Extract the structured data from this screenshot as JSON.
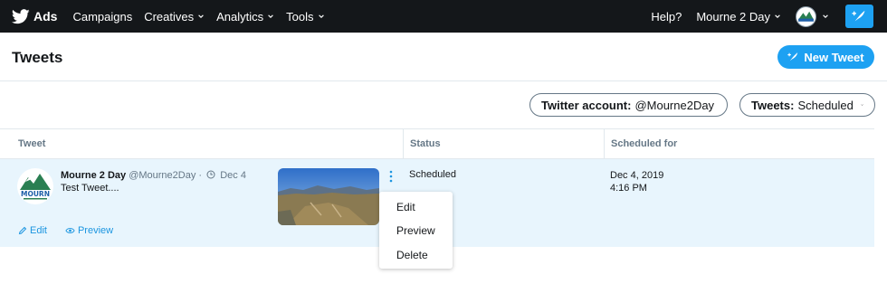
{
  "nav": {
    "brand": "Ads",
    "items": [
      {
        "label": "Campaigns",
        "has_dropdown": false
      },
      {
        "label": "Creatives",
        "has_dropdown": true
      },
      {
        "label": "Analytics",
        "has_dropdown": true
      },
      {
        "label": "Tools",
        "has_dropdown": true
      }
    ],
    "help": "Help?",
    "account": "Mourne 2 Day"
  },
  "header": {
    "title": "Tweets",
    "new_tweet": "New Tweet"
  },
  "filters": [
    {
      "label": "Twitter account:",
      "value": "@Mourne2Day"
    },
    {
      "label": "Tweets:",
      "value": "Scheduled"
    }
  ],
  "table": {
    "columns": [
      "Tweet",
      "Status",
      "Scheduled for"
    ],
    "rows": [
      {
        "name": "Mourne 2 Day",
        "handle": "@Mourne2Day",
        "separator": "·",
        "date": "Dec 4",
        "text": "Test Tweet....",
        "actions": [
          "Edit",
          "Preview"
        ],
        "status": "Scheduled",
        "scheduled_date": "Dec 4, 2019",
        "scheduled_time": "4:16 PM"
      }
    ]
  },
  "menu": [
    "Edit",
    "Preview",
    "Delete"
  ],
  "avatar_text": "MOURN",
  "colors": {
    "nav_bg": "#14171a",
    "accent": "#1da1f2",
    "link": "#1b95e0",
    "row_highlight": "#e8f5fd"
  }
}
